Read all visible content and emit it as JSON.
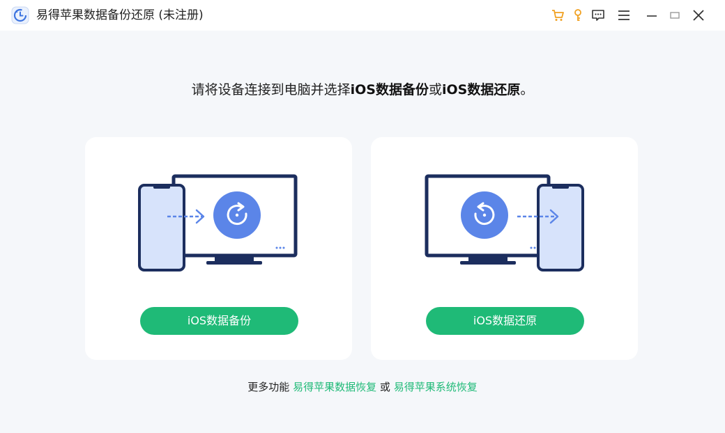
{
  "titlebar": {
    "title": "易得苹果数据备份还原 (未注册)",
    "icons": [
      "app-logo-icon",
      "cart-icon",
      "key-icon",
      "feedback-icon",
      "menu-icon",
      "minimize-icon",
      "maximize-icon",
      "close-icon"
    ]
  },
  "main": {
    "instruction_prefix": "请将设备连接到电脑并选择",
    "instruction_bold1": "iOS数据备份",
    "instruction_or": "或",
    "instruction_bold2": "iOS数据还原",
    "instruction_suffix": "。"
  },
  "cards": {
    "backup": {
      "button_label": "iOS数据备份"
    },
    "restore": {
      "button_label": "iOS数据还原"
    }
  },
  "footer": {
    "prefix": "更多功能",
    "link1": "易得苹果数据恢复",
    "or": "或",
    "link2": "易得苹果系统恢复"
  },
  "colors": {
    "accent_green": "#1fba77",
    "navy": "#1c2e5e",
    "blue": "#5b85e8",
    "orange": "#f0a020",
    "background": "#f5f7fa"
  }
}
